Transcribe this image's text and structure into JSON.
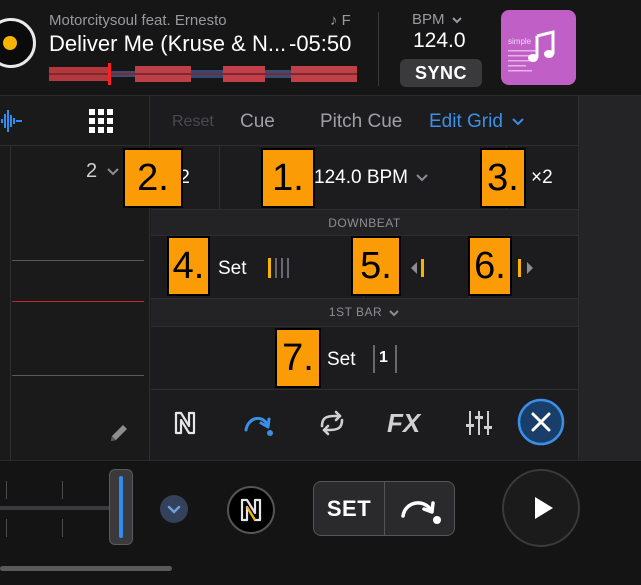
{
  "header": {
    "artist": "Motorcitysoul feat. Ernesto",
    "key_symbol": "♪",
    "key": "F",
    "title": "Deliver Me (Kruse & N...",
    "remaining_time": "-05:50",
    "bpm_label": "BPM",
    "bpm_value": "124.0",
    "sync_label": "SYNC",
    "artwork_text": "simple"
  },
  "left_panel": {
    "beats_value": "2"
  },
  "tabs": {
    "reset": "Reset",
    "cue": "Cue",
    "pitch_cue": "Pitch Cue",
    "edit_grid": "Edit Grid"
  },
  "grid_edit": {
    "halve_label": "/2",
    "bpm_display": "124.0 BPM",
    "double_label": "×2",
    "downbeat_section": "DOWNBEAT",
    "downbeat_set_label": "Set",
    "first_bar_section": "1ST BAR",
    "first_bar_set_label": "Set",
    "first_bar_marker": "1"
  },
  "annotations": {
    "badge_1": "1.",
    "badge_2": "2.",
    "badge_3": "3.",
    "badge_4": "4.",
    "badge_5": "5.",
    "badge_6": "6.",
    "badge_7": "7."
  },
  "toolbar": {
    "fx_label": "FX"
  },
  "deck": {
    "set_label": "SET"
  },
  "colors": {
    "accent_blue": "#3a8fe6",
    "annotation_orange": "#fb9b06",
    "deck_yellow": "#f6b400",
    "playhead_red": "#c0282d",
    "artwork_purple": "#c05fc6"
  }
}
